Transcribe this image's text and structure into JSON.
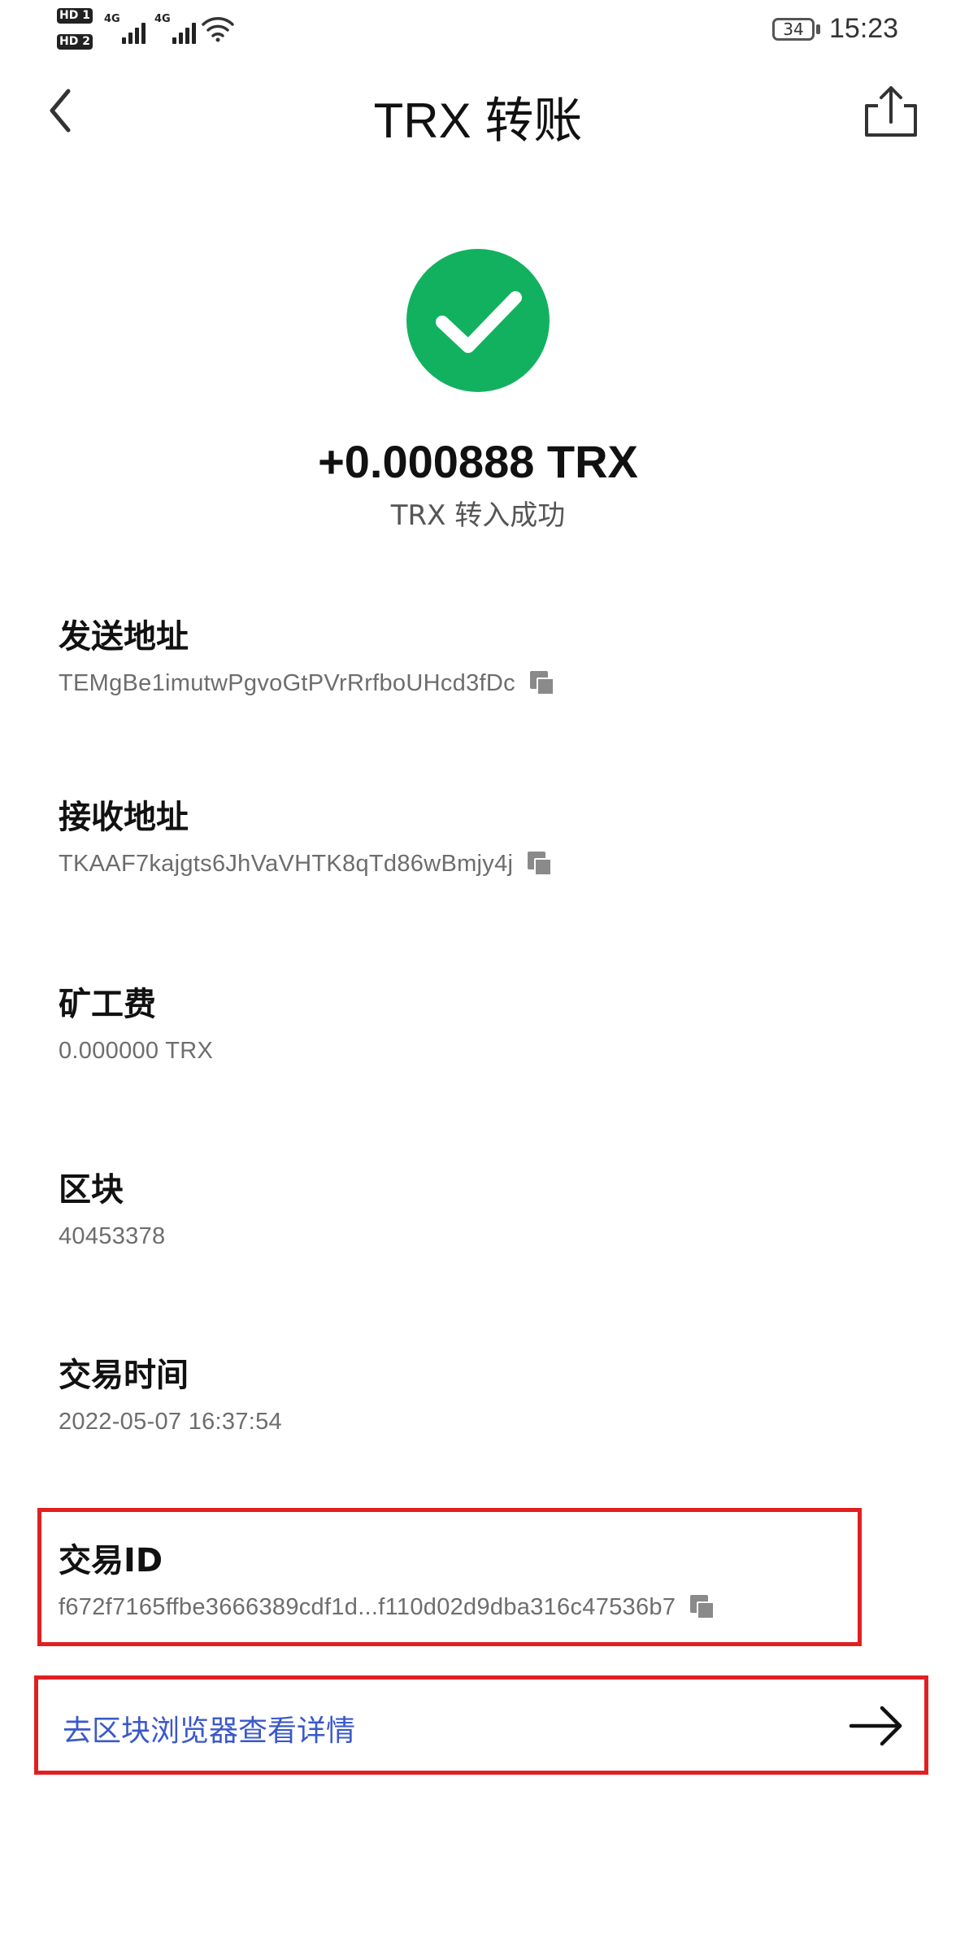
{
  "status_bar": {
    "sim1": "HD 1",
    "sim2": "HD 2",
    "signal1": "4G",
    "signal2": "4G",
    "battery": "34",
    "time": "15:23"
  },
  "nav": {
    "title": "TRX 转账",
    "back_icon": "chevron-left-icon",
    "share_icon": "share-icon"
  },
  "result": {
    "icon": "check-icon",
    "color": "#12b15f",
    "amount": "+0.000888 TRX",
    "status": "TRX 转入成功"
  },
  "fields": {
    "from": {
      "label": "发送地址",
      "value": "TEMgBe1imutwPgvoGtPVrRrfboUHcd3fDc"
    },
    "to": {
      "label": "接收地址",
      "value": "TKAAF7kajgts6JhVaVHTK8qTd86wBmjy4j"
    },
    "fee": {
      "label": "矿工费",
      "value": "0.000000 TRX"
    },
    "block": {
      "label": "区块",
      "value": "40453378"
    },
    "time": {
      "label": "交易时间",
      "value": "2022-05-07 16:37:54"
    },
    "txid": {
      "label": "交易ID",
      "value": "f672f7165ffbe3666389cdf1d...f110d02d9dba316c47536b7"
    }
  },
  "explorer_link": {
    "label": "去区块浏览器查看详情",
    "icon": "arrow-right-icon"
  },
  "colors": {
    "highlight": "#e02020",
    "link": "#3a58c9"
  }
}
